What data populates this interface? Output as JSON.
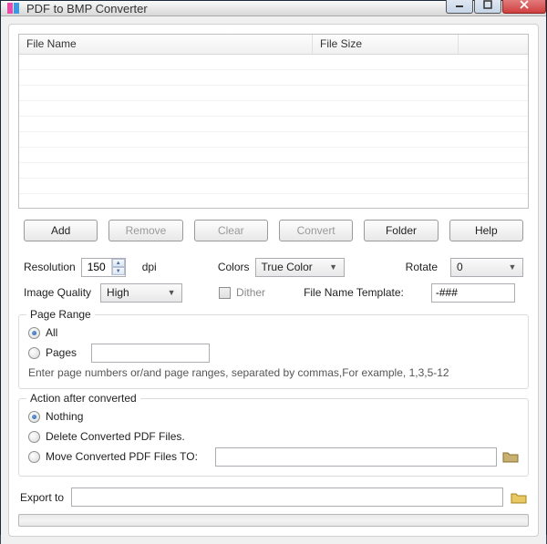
{
  "window": {
    "title": "PDF to BMP Converter"
  },
  "listview": {
    "columns": {
      "filename": "File Name",
      "filesize": "File Size"
    },
    "rows": []
  },
  "buttons": {
    "add": "Add",
    "remove": "Remove",
    "clear": "Clear",
    "convert": "Convert",
    "folder": "Folder",
    "help": "Help"
  },
  "settings": {
    "resolution_label": "Resolution",
    "resolution_value": "150",
    "resolution_unit": "dpi",
    "colors_label": "Colors",
    "colors_value": "True Color",
    "rotate_label": "Rotate",
    "rotate_value": "0",
    "image_quality_label": "Image Quality",
    "image_quality_value": "High",
    "dither_label": "Dither",
    "filename_template_label": "File Name Template:",
    "filename_template_value": "-###"
  },
  "page_range": {
    "title": "Page Range",
    "all_label": "All",
    "pages_label": "Pages",
    "pages_value": "",
    "hint": "Enter page numbers or/and page ranges, separated by commas,For example, 1,3,5-12"
  },
  "action": {
    "title": "Action after converted",
    "nothing_label": "Nothing",
    "delete_label": "Delete Converted PDF Files.",
    "move_label": "Move Converted PDF Files TO:",
    "move_path": ""
  },
  "export": {
    "label": "Export to",
    "path": ""
  }
}
